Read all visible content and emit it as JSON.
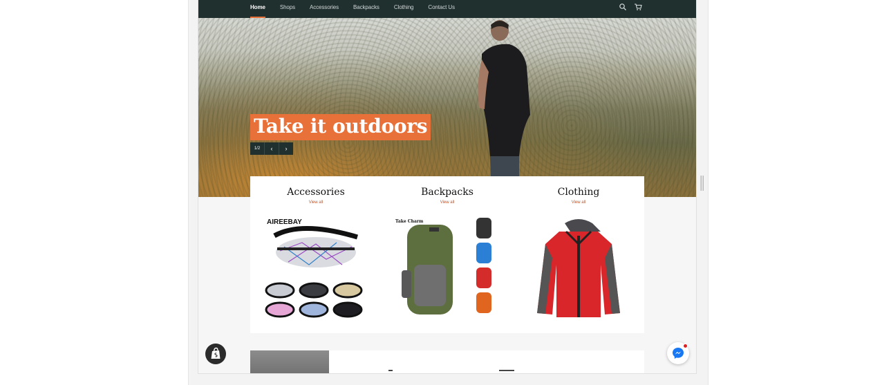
{
  "nav": {
    "items": [
      {
        "label": "Home",
        "active": true
      },
      {
        "label": "Shops",
        "active": false
      },
      {
        "label": "Accessories",
        "active": false
      },
      {
        "label": "Backpacks",
        "active": false
      },
      {
        "label": "Clothing",
        "active": false
      },
      {
        "label": "Contact Us",
        "active": false
      }
    ],
    "icons": [
      "search-icon",
      "cart-icon"
    ]
  },
  "hero": {
    "title": "Take it outdoors",
    "slide_counter": "1/2",
    "prev_icon": "‹",
    "next_icon": "›"
  },
  "collections": [
    {
      "title": "Accessories",
      "link": "View all",
      "image_brand": "AIREEBAY"
    },
    {
      "title": "Backpacks",
      "link": "View all",
      "image_brand": "Take Charm"
    },
    {
      "title": "Clothing",
      "link": "View all"
    }
  ],
  "colors": {
    "header_bg": "#20302f",
    "accent": "#e8713a",
    "link": "#c2552a",
    "page_bg": "#f6f6f6"
  },
  "floating": {
    "shopify_icon": "shopify-bag-icon",
    "messenger_icon": "messenger-icon"
  }
}
